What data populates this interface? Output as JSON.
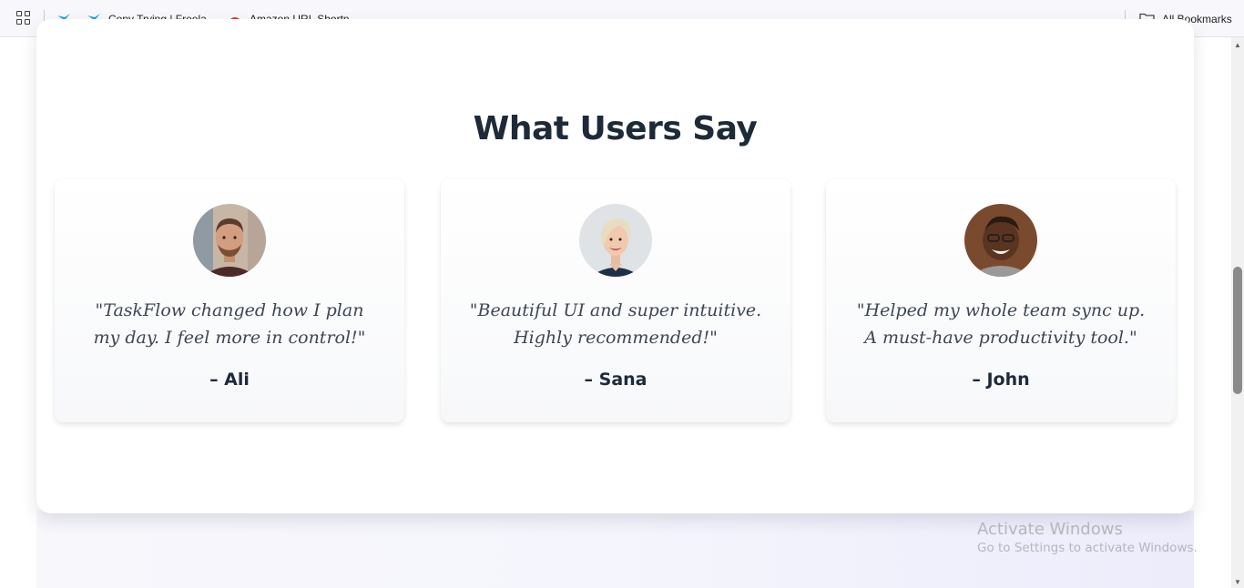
{
  "bookmarks_bar": {
    "items": [
      {
        "label": "",
        "icon": "bird-icon"
      },
      {
        "label": "Copy Trying | Freela...",
        "icon": "bird-icon"
      },
      {
        "label": "Amazon URL Shortn...",
        "icon": "amazon-rainbow-icon"
      }
    ],
    "all_bookmarks": "All Bookmarks"
  },
  "section": {
    "title": "What Users Say"
  },
  "testimonials": [
    {
      "quote": "\"TaskFlow changed how I plan my day. I feel more in control!\"",
      "author": "– Ali"
    },
    {
      "quote": "\"Beautiful UI and super intuitive. Highly recommended!\"",
      "author": "– Sana"
    },
    {
      "quote": "\"Helped my whole team sync up. A must-have productivity tool.\"",
      "author": "– John"
    }
  ],
  "overlay": {
    "title": "Activate Windows",
    "subtitle": "Go to Settings to activate Windows."
  },
  "colors": {
    "heading": "#1e2a38",
    "quote_text": "#3d4652",
    "panel_bg": "#ffffff",
    "page_bg": "#f4f4fb"
  }
}
